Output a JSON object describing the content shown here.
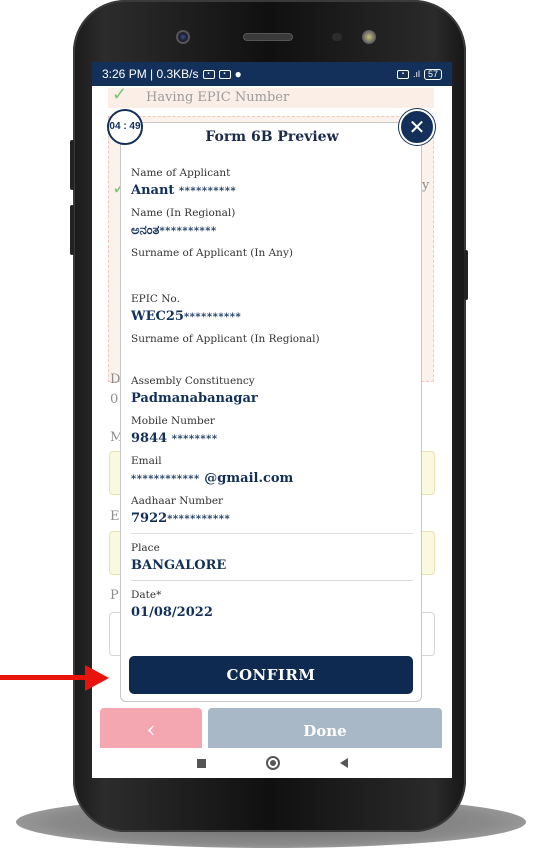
{
  "status_bar": {
    "time_network": "3:26 PM | 0.3KB/s",
    "battery": "57"
  },
  "background": {
    "epic_option": "Having EPIC Number",
    "partial_letters": [
      "D",
      "0",
      "M",
      "E",
      "P"
    ],
    "partial_y": "y",
    "done_label": "Done"
  },
  "modal": {
    "timer": "04 : 49",
    "title": "Form 6B Preview",
    "fields": {
      "name": {
        "label": "Name of Applicant",
        "value": "Anant",
        "mask": "**********"
      },
      "name_regional": {
        "label": "Name (In Regional)",
        "value": "ಅನಂತ",
        "mask": "**********"
      },
      "surname": {
        "label": "Surname of Applicant (In Any)"
      },
      "epic": {
        "label": "EPIC No.",
        "value": "WEC25",
        "mask": "**********"
      },
      "surname_regional": {
        "label": "Surname of Applicant (In Regional)"
      },
      "assembly": {
        "label": "Assembly Constituency",
        "value": "Padmanabanagar"
      },
      "mobile": {
        "label": "Mobile Number",
        "value": "9844",
        "mask": "********"
      },
      "email": {
        "label": "Email",
        "mask": "************",
        "value": "@gmail.com"
      },
      "aadhaar": {
        "label": "Aadhaar Number",
        "value": "7922",
        "mask": "***********"
      },
      "place": {
        "label": "Place",
        "value": "BANGALORE"
      },
      "date": {
        "label": "Date*",
        "value": "01/08/2022"
      }
    },
    "confirm_label": "CONFIRM"
  },
  "colors": {
    "primary_navy": "#12305a",
    "annotation_red": "#e8140c"
  }
}
